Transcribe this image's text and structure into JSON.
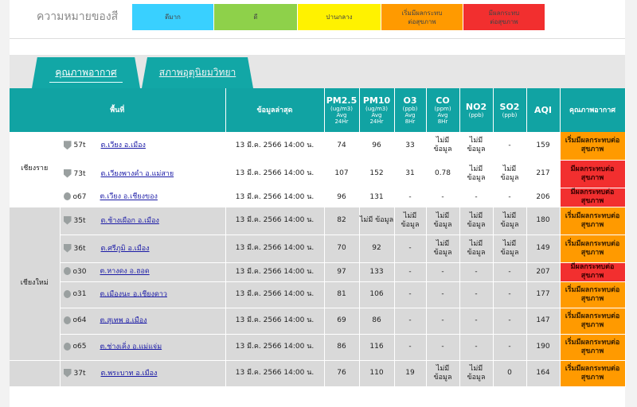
{
  "legend": {
    "title": "ความหมายของสี",
    "items": [
      {
        "label": "ดีมาก",
        "color": "#39d0ff"
      },
      {
        "label": "ดี",
        "color": "#8ed14a"
      },
      {
        "label": "ปานกลาง",
        "color": "#fff200"
      },
      {
        "label": "เริ่มมีผลกระทบ\nต่อสุขภาพ",
        "color": "#ff9a00"
      },
      {
        "label": "มีผลกระทบ\nต่อสุขภาพ",
        "color": "#f22f2f"
      }
    ]
  },
  "tabs": [
    {
      "label": "คุณภาพอากาศ",
      "active": true
    },
    {
      "label": "สภาพอุตุนิยมวิทยา",
      "active": false
    }
  ],
  "columns": {
    "area": "พื้นที่",
    "latest": "ข้อมูลล่าสุด",
    "pm25": "PM2.5",
    "pm25_unit": "(ug/m3)",
    "pm25_avg": "Avg",
    "pm25_hr": "24Hr",
    "pm10": "PM10",
    "pm10_unit": "(ug/m3)",
    "pm10_avg": "Avg",
    "pm10_hr": "24Hr",
    "o3": "O3",
    "o3_unit": "(ppb)",
    "o3_avg": "Avg",
    "o3_hr": "8Hr",
    "co": "CO",
    "co_unit": "(ppm)",
    "co_avg": "Avg",
    "co_hr": "8Hr",
    "no2": "NO2",
    "no2_unit": "(ppb)",
    "so2": "SO2",
    "so2_unit": "(ppb)",
    "aqi": "AQI",
    "quality": "คุณภาพอากาศ"
  },
  "provinces": [
    {
      "name": "เชียงราย"
    },
    {
      "name": "เชียงใหม่"
    }
  ],
  "rows": [
    {
      "id": "57t",
      "area": "ต.เวียง อ.เมือง",
      "time": "13 มี.ค. 2566 14:00 น.",
      "pm25": "74",
      "pm10": "96",
      "o3": "33",
      "co": "ไม่มี ข้อมูล",
      "no2": "ไม่มี ข้อมูล",
      "so2": "-",
      "aqi": "159",
      "quality": "เริ่มมีผลกระทบต่อสุขภาพ"
    },
    {
      "id": "73t",
      "area": "ต.เวียงพางคำ อ.แม่สาย",
      "time": "13 มี.ค. 2566 14:00 น.",
      "pm25": "107",
      "pm10": "152",
      "o3": "31",
      "co": "0.78",
      "no2": "ไม่มี ข้อมูล",
      "so2": "ไม่มี ข้อมูล",
      "aqi": "217",
      "quality": "มีผลกระทบต่อสุขภาพ"
    },
    {
      "id": "o67",
      "area": "ต.เวียง อ.เชียงของ",
      "time": "13 มี.ค. 2566 14:00 น.",
      "pm25": "96",
      "pm10": "131",
      "o3": "-",
      "co": "-",
      "no2": "-",
      "so2": "-",
      "aqi": "206",
      "quality": "มีผลกระทบต่อสุขภาพ"
    },
    {
      "id": "35t",
      "area": "ต.ช้างเผือก อ.เมือง",
      "time": "13 มี.ค. 2566 14:00 น.",
      "pm25": "82",
      "pm10": "ไม่มี ข้อมูล",
      "o3": "ไม่มี ข้อมูล",
      "co": "ไม่มี ข้อมูล",
      "no2": "ไม่มี ข้อมูล",
      "so2": "ไม่มี ข้อมูล",
      "aqi": "180",
      "quality": "เริ่มมีผลกระทบต่อสุขภาพ"
    },
    {
      "id": "36t",
      "area": "ต.ศรีภูมิ อ.เมือง",
      "time": "13 มี.ค. 2566 14:00 น.",
      "pm25": "70",
      "pm10": "92",
      "o3": "-",
      "co": "ไม่มี ข้อมูล",
      "no2": "ไม่มี ข้อมูล",
      "so2": "ไม่มี ข้อมูล",
      "aqi": "149",
      "quality": "เริ่มมีผลกระทบต่อสุขภาพ"
    },
    {
      "id": "o30",
      "area": "ต.หางดง อ.ฮอด",
      "time": "13 มี.ค. 2566 14:00 น.",
      "pm25": "97",
      "pm10": "133",
      "o3": "-",
      "co": "-",
      "no2": "-",
      "so2": "-",
      "aqi": "207",
      "quality": "มีผลกระทบต่อสุขภาพ"
    },
    {
      "id": "o31",
      "area": "ต.เมืองนะ อ.เชียงดาว",
      "time": "13 มี.ค. 2566 14:00 น.",
      "pm25": "81",
      "pm10": "106",
      "o3": "-",
      "co": "-",
      "no2": "-",
      "so2": "-",
      "aqi": "177",
      "quality": "เริ่มมีผลกระทบต่อสุขภาพ"
    },
    {
      "id": "o64",
      "area": "ต.สุเทพ อ.เมือง",
      "time": "13 มี.ค. 2566 14:00 น.",
      "pm25": "69",
      "pm10": "86",
      "o3": "-",
      "co": "-",
      "no2": "-",
      "so2": "-",
      "aqi": "147",
      "quality": "เริ่มมีผลกระทบต่อสุขภาพ"
    },
    {
      "id": "o65",
      "area": "ต.ช่างเคิ่ง อ.แม่แจ่ม",
      "time": "13 มี.ค. 2566 14:00 น.",
      "pm25": "86",
      "pm10": "116",
      "o3": "-",
      "co": "-",
      "no2": "-",
      "so2": "-",
      "aqi": "190",
      "quality": "เริ่มมีผลกระทบต่อสุขภาพ"
    },
    {
      "id": "37t",
      "area": "ต.พระบาท อ.เมือง",
      "time": "13 มี.ค. 2566 14:00 น.",
      "pm25": "76",
      "pm10": "110",
      "o3": "19",
      "co": "ไม่มี ข้อมูล",
      "no2": "ไม่มี ข้อมูล",
      "so2": "0",
      "aqi": "164",
      "quality": "เริ่มมีผลกระทบต่อสุขภาพ"
    }
  ],
  "colors": {
    "teal": "#11a3a3",
    "orange": "#ff9a00",
    "red": "#f22f2f",
    "link": "#1a1aa6"
  }
}
